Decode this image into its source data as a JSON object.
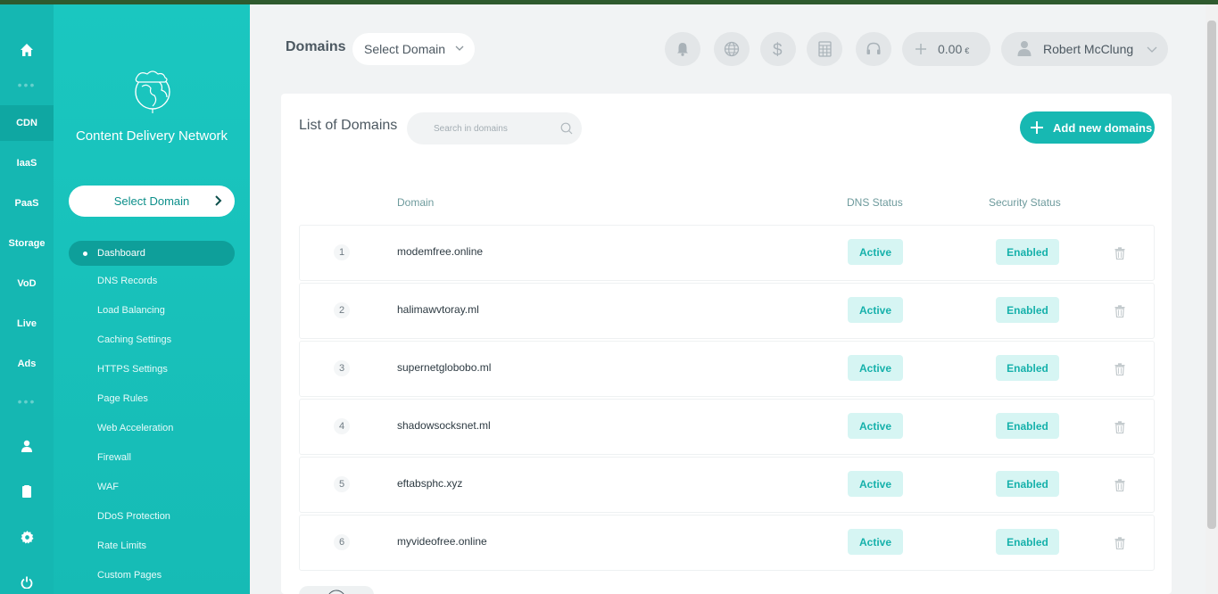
{
  "rail": {
    "items": [
      {
        "label": "CDN"
      },
      {
        "label": "IaaS"
      },
      {
        "label": "PaaS"
      },
      {
        "label": "Storage"
      },
      {
        "label": "VoD"
      },
      {
        "label": "Live"
      },
      {
        "label": "Ads"
      }
    ],
    "icons": [
      "home-icon",
      "user-icon",
      "clipboard-icon",
      "gear-icon",
      "power-icon"
    ]
  },
  "sidebar": {
    "title": "Content Delivery Network",
    "select_domain": "Select Domain",
    "menu": [
      {
        "label": "Dashboard"
      },
      {
        "label": "DNS Records"
      },
      {
        "label": "Load Balancing"
      },
      {
        "label": "Caching Settings"
      },
      {
        "label": "HTTPS Settings"
      },
      {
        "label": "Page Rules"
      },
      {
        "label": "Web Acceleration"
      },
      {
        "label": "Firewall"
      },
      {
        "label": "WAF"
      },
      {
        "label": "DDoS Protection"
      },
      {
        "label": "Rate Limits"
      },
      {
        "label": "Custom Pages"
      }
    ]
  },
  "header": {
    "title": "Domains",
    "domain_select": "Select Domain",
    "balance": "0.00",
    "currency": "€",
    "user_name": "Robert McClung"
  },
  "card": {
    "title": "List of Domains",
    "search_placeholder": "Search in domains",
    "add_button": "Add new domains",
    "columns": {
      "domain": "Domain",
      "dns": "DNS Status",
      "security": "Security Status"
    },
    "rows": [
      {
        "num": "1",
        "domain": "modemfree.online",
        "dns": "Active",
        "security": "Enabled"
      },
      {
        "num": "2",
        "domain": "halimawvtoray.ml",
        "dns": "Active",
        "security": "Enabled"
      },
      {
        "num": "3",
        "domain": "supernetglobobo.ml",
        "dns": "Active",
        "security": "Enabled"
      },
      {
        "num": "4",
        "domain": "shadowsocksnet.ml",
        "dns": "Active",
        "security": "Enabled"
      },
      {
        "num": "5",
        "domain": "eftabsphc.xyz",
        "dns": "Active",
        "security": "Enabled"
      },
      {
        "num": "6",
        "domain": "myvideofree.online",
        "dns": "Active",
        "security": "Enabled"
      }
    ]
  },
  "colors": {
    "accent": "#17b8b2",
    "sidebar": "#1ac7c0",
    "badge_bg": "#d6f5f3"
  }
}
